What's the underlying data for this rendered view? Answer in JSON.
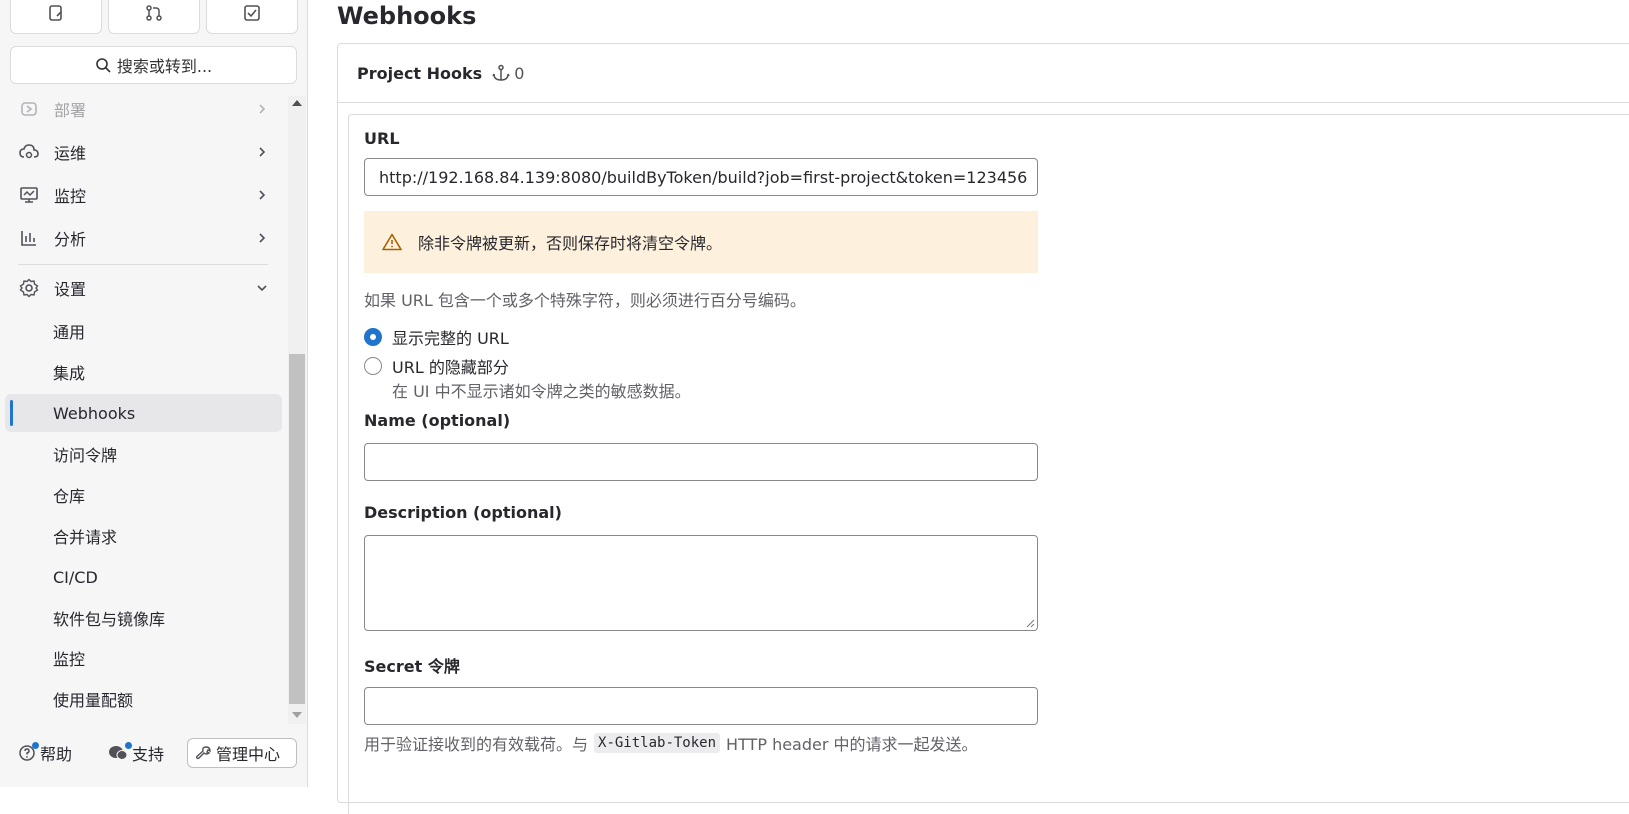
{
  "sidebar": {
    "search_label": "搜索或转到...",
    "nav": [
      {
        "label": "部署",
        "icon": "deploy-icon"
      },
      {
        "label": "运维",
        "icon": "operate-icon"
      },
      {
        "label": "监控",
        "icon": "monitor-icon"
      },
      {
        "label": "分析",
        "icon": "analytics-icon"
      },
      {
        "label": "设置",
        "icon": "settings-icon"
      }
    ],
    "sub_items": [
      {
        "label": "通用"
      },
      {
        "label": "集成"
      },
      {
        "label": "Webhooks",
        "active": true
      },
      {
        "label": "访问令牌"
      },
      {
        "label": "仓库"
      },
      {
        "label": "合并请求"
      },
      {
        "label": "CI/CD"
      },
      {
        "label": "软件包与镜像库"
      },
      {
        "label": "监控"
      },
      {
        "label": "使用量配额"
      }
    ],
    "footer": {
      "help": "帮助",
      "support": "支持",
      "admin": "管理中心"
    }
  },
  "main": {
    "title": "Webhooks",
    "card_title": "Project Hooks",
    "hook_count": "0",
    "form": {
      "url_label": "URL",
      "url_value": "http://192.168.84.139:8080/buildByToken/build?job=first-project&token=123456",
      "warning": "除非令牌被更新，否则保存时将清空令牌。",
      "url_help": "如果 URL 包含一个或多个特殊字符，则必须进行百分号编码。",
      "radio_full": "显示完整的 URL",
      "radio_mask": "URL 的隐藏部分",
      "radio_mask_help": "在 UI 中不显示诸如令牌之类的敏感数据。",
      "name_label": "Name (optional)",
      "description_label": "Description (optional)",
      "secret_label": "Secret 令牌",
      "secret_help_prefix": "用于验证接收到的有效载荷。与",
      "secret_help_code": "X-Gitlab-Token",
      "secret_help_suffix": "HTTP header 中的请求一起发送。"
    }
  },
  "colors": {
    "accent": "#1f75cb",
    "warning_bg": "#fdf1dd",
    "warning_icon": "#ab6100"
  }
}
